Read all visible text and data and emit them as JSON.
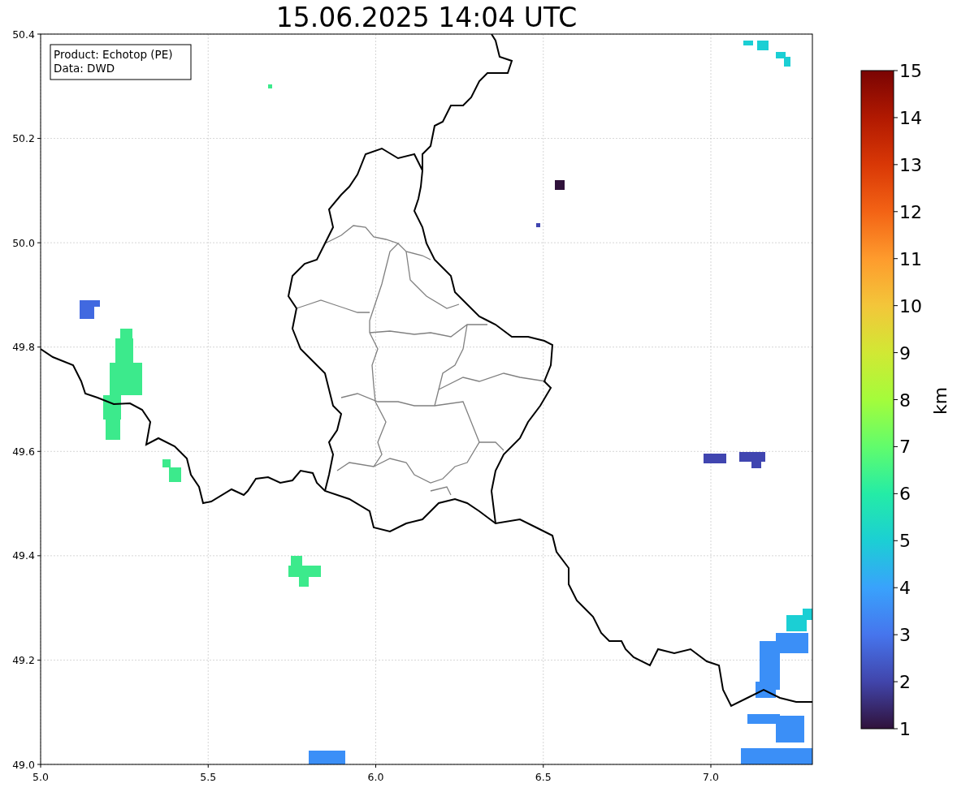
{
  "title": "15.06.2025 14:04 UTC",
  "info_box": [
    "Product: Echotop (PE)",
    "Data: DWD"
  ],
  "y_ticks": [
    "50.4",
    "50.2",
    "50.0",
    "49.8",
    "49.6",
    "49.4",
    "49.2",
    "49.0"
  ],
  "x_ticks": [
    "5.0",
    "5.5",
    "6.0",
    "6.5",
    "7.0"
  ],
  "colorbar": {
    "label": "km",
    "ticks": [
      "15",
      "14",
      "13",
      "12",
      "11",
      "10",
      "9",
      "8",
      "7",
      "6",
      "5",
      "4",
      "3",
      "2",
      "1"
    ]
  }
}
